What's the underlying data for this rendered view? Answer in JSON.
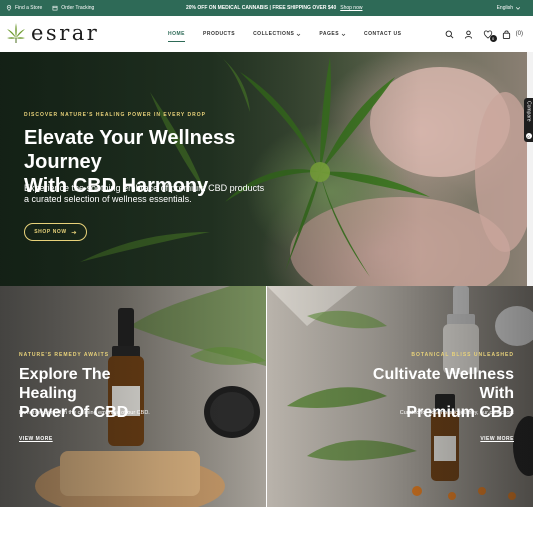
{
  "topbar": {
    "store_label": "Find a Store",
    "tracking_label": "Order Tracking",
    "promo_text": "20% OFF ON MEDICAL CANNABIS | FREE SHIPPING OVER $40",
    "promo_link": "Shop now",
    "language": "English"
  },
  "header": {
    "logo_text": "esrar",
    "nav": [
      {
        "label": "HOME",
        "active": true
      },
      {
        "label": "PRODUCTS"
      },
      {
        "label": "COLLECTIONS"
      },
      {
        "label": "PAGES"
      },
      {
        "label": "CONTACT US"
      }
    ],
    "wishlist_count": "0",
    "cart_count": "(0)"
  },
  "hero": {
    "kicker": "DISCOVER NATURE'S HEALING POWER IN EVERY DROP",
    "title_line1": "Elevate Your Wellness Journey",
    "title_line2": "With CBD Harmony",
    "sub_line1": "Experience the soothing embrace of premium CBD products",
    "sub_line2": "a curated selection of wellness essentials.",
    "button": "SHOP NOW"
  },
  "compare": {
    "label": "Compare",
    "count": "0"
  },
  "promos": [
    {
      "kicker": "NATURE'S REMEDY AWAITS",
      "title_line1": "Explore The Healing",
      "title_line2": "Power Of CBD",
      "sub": "Immerse yourself in the calming embrace of our CBD.",
      "link": "VIEW MORE"
    },
    {
      "kicker": "BOTANICAL BLISS UNLEASHED",
      "title_line1": "Cultivate Wellness With",
      "title_line2": "Premium CBD",
      "sub": "Curated for your holistic journey, our collection.",
      "link": "VIEW MORE"
    }
  ],
  "colors": {
    "brand_green": "#2e6a57",
    "accent_gold": "#e8d27a"
  }
}
